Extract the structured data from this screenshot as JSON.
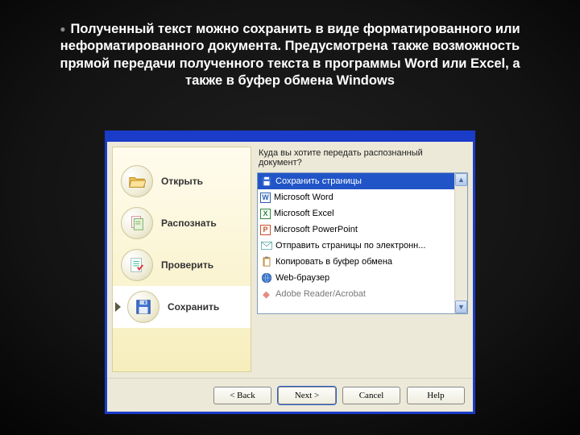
{
  "slide": {
    "paragraph": "Полученный текст можно сохранить в виде форматированного или неформатированного документа. Предусмотрена также возможность прямой передачи полученного текста в программы Word или Excel, а также в буфер обмена Windows"
  },
  "sidebar": {
    "items": [
      {
        "label": "Открыть"
      },
      {
        "label": "Распознать"
      },
      {
        "label": "Проверить"
      },
      {
        "label": "Сохранить"
      }
    ]
  },
  "panel": {
    "question": "Куда вы хотите передать распознанный документ?",
    "items": [
      {
        "label": "Сохранить страницы"
      },
      {
        "label": "Microsoft Word"
      },
      {
        "label": "Microsoft Excel"
      },
      {
        "label": "Microsoft PowerPoint"
      },
      {
        "label": "Отправить страницы по электронн..."
      },
      {
        "label": "Копировать в буфер обмена"
      },
      {
        "label": "Web-браузер"
      },
      {
        "label": "Adobe Reader/Acrobat"
      }
    ]
  },
  "buttons": {
    "back": "< Back",
    "next": "Next >",
    "cancel": "Cancel",
    "help": "Help"
  }
}
